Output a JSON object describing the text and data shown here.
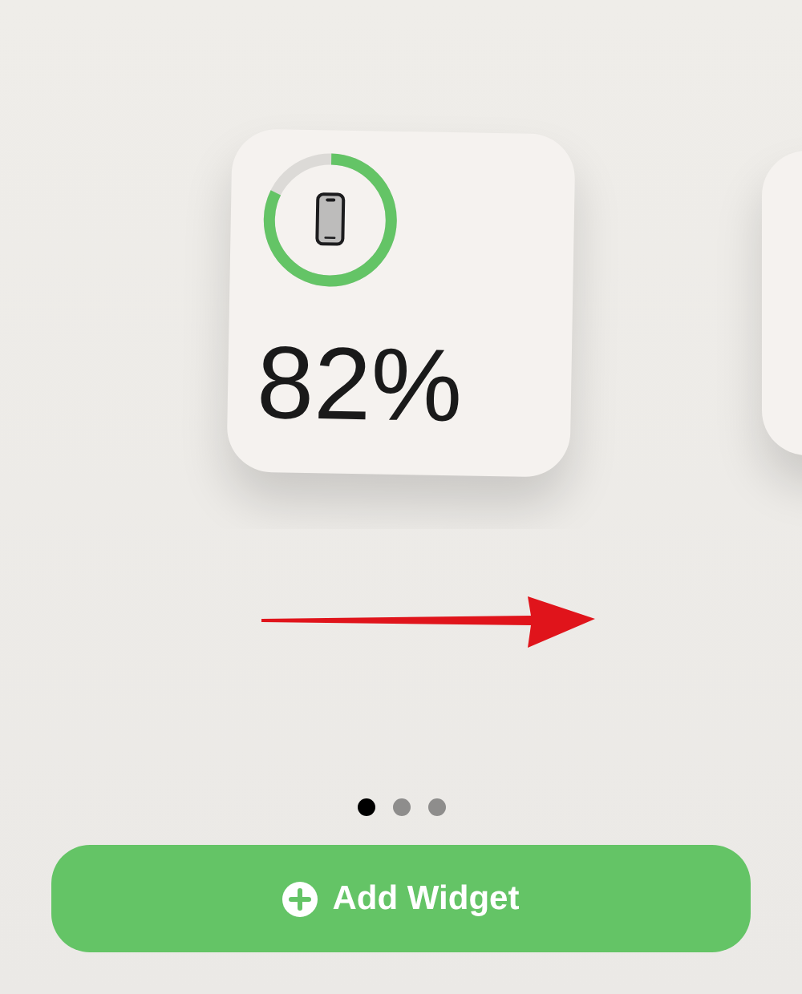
{
  "widgets": [
    {
      "kind": "battery",
      "level": 0.82,
      "reading": "82%"
    },
    {
      "kind": "blank"
    }
  ],
  "page_dots": [
    {
      "selected": true
    },
    {
      "selected": false
    },
    {
      "selected": false
    }
  ],
  "add_button": {
    "label": "Add Widget"
  }
}
